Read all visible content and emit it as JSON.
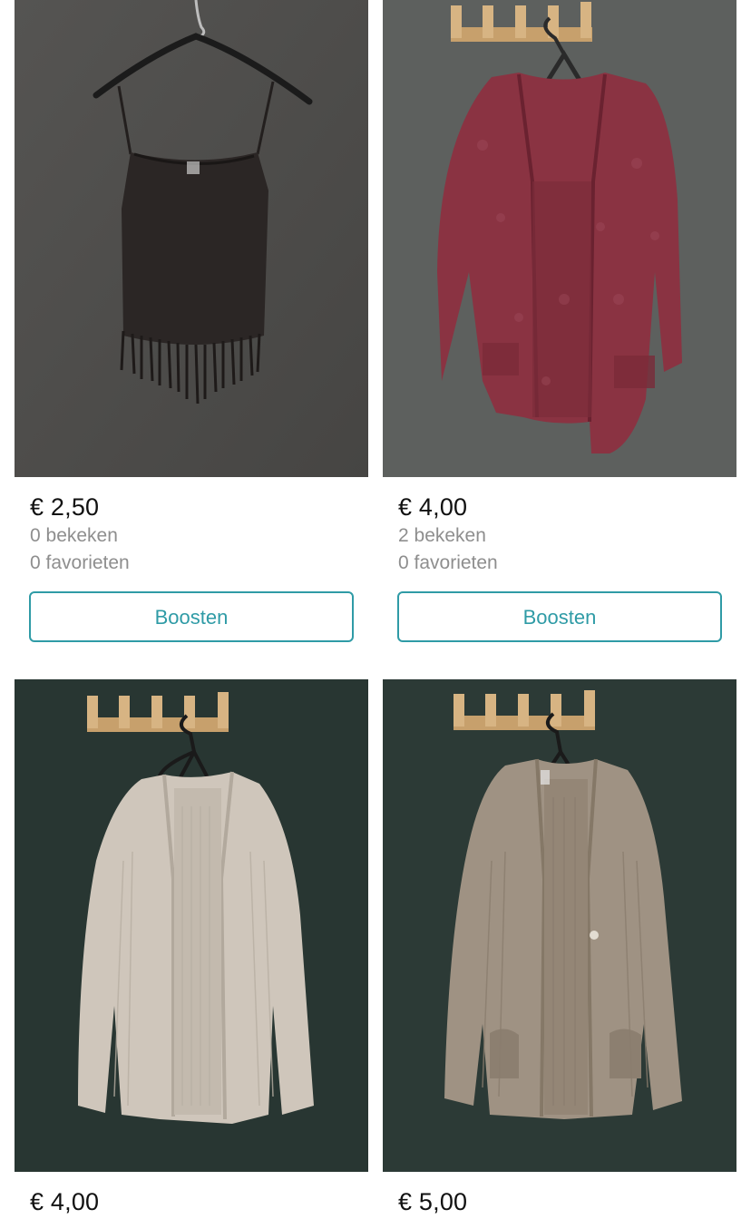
{
  "listings": [
    {
      "price": "€ 2,50",
      "views": "0 bekeken",
      "favorites": "0 favorieten",
      "button": "Boosten",
      "photo": {
        "subject": "black camisole with fringe",
        "wall": "#4f4e4c",
        "garment": "#2b2625"
      }
    },
    {
      "price": "€ 4,00",
      "views": "2 bekeken",
      "favorites": "0 favorieten",
      "button": "Boosten",
      "photo": {
        "subject": "burgundy knit cardigan",
        "wall": "#5d605e",
        "garment": "#8a3342"
      }
    },
    {
      "price": "€ 4,00",
      "photo": {
        "subject": "light grey knit cardigan",
        "wall": "#283632",
        "garment": "#cfc6bb"
      }
    },
    {
      "price": "€ 5,00",
      "photo": {
        "subject": "taupe knit cardigan with pockets",
        "wall": "#2c3a36",
        "garment": "#9f9283"
      }
    }
  ],
  "colors": {
    "accent": "#2f9ba6",
    "muted_text": "#8e8e8e",
    "price_text": "#111111"
  }
}
